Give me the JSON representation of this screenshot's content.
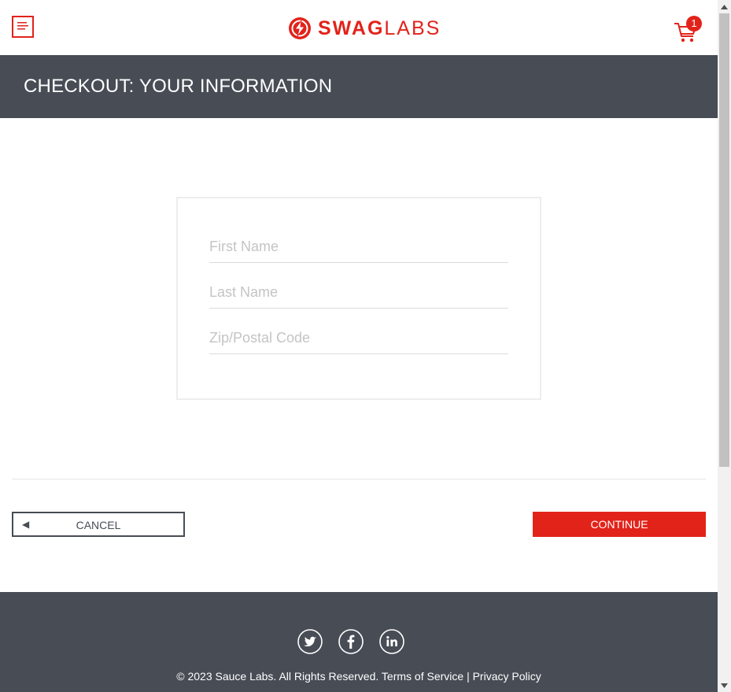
{
  "header": {
    "menu_icon": "hamburger-menu-icon",
    "logo": {
      "bold": "SWAG",
      "light": "LABS",
      "icon": "lightning-bolt-circle-icon"
    },
    "cart": {
      "icon": "shopping-cart-icon",
      "badge_count": "1"
    }
  },
  "page": {
    "title": "CHECKOUT: YOUR INFORMATION"
  },
  "form": {
    "first_name": {
      "value": "",
      "placeholder": "First Name"
    },
    "last_name": {
      "value": "",
      "placeholder": "Last Name"
    },
    "postal_code": {
      "value": "",
      "placeholder": "Zip/Postal Code"
    }
  },
  "actions": {
    "cancel_arrow": "◀",
    "cancel_label": "CANCEL",
    "continue_label": "CONTINUE"
  },
  "footer": {
    "social": [
      "twitter-icon",
      "facebook-icon",
      "linkedin-icon"
    ],
    "copyright": "© 2023 Sauce Labs. All Rights Reserved.",
    "terms": "Terms of Service",
    "separator": "|",
    "privacy": "Privacy Policy"
  },
  "colors": {
    "accent": "#e2231a",
    "dark": "#474c55",
    "background": "#ffffff"
  }
}
